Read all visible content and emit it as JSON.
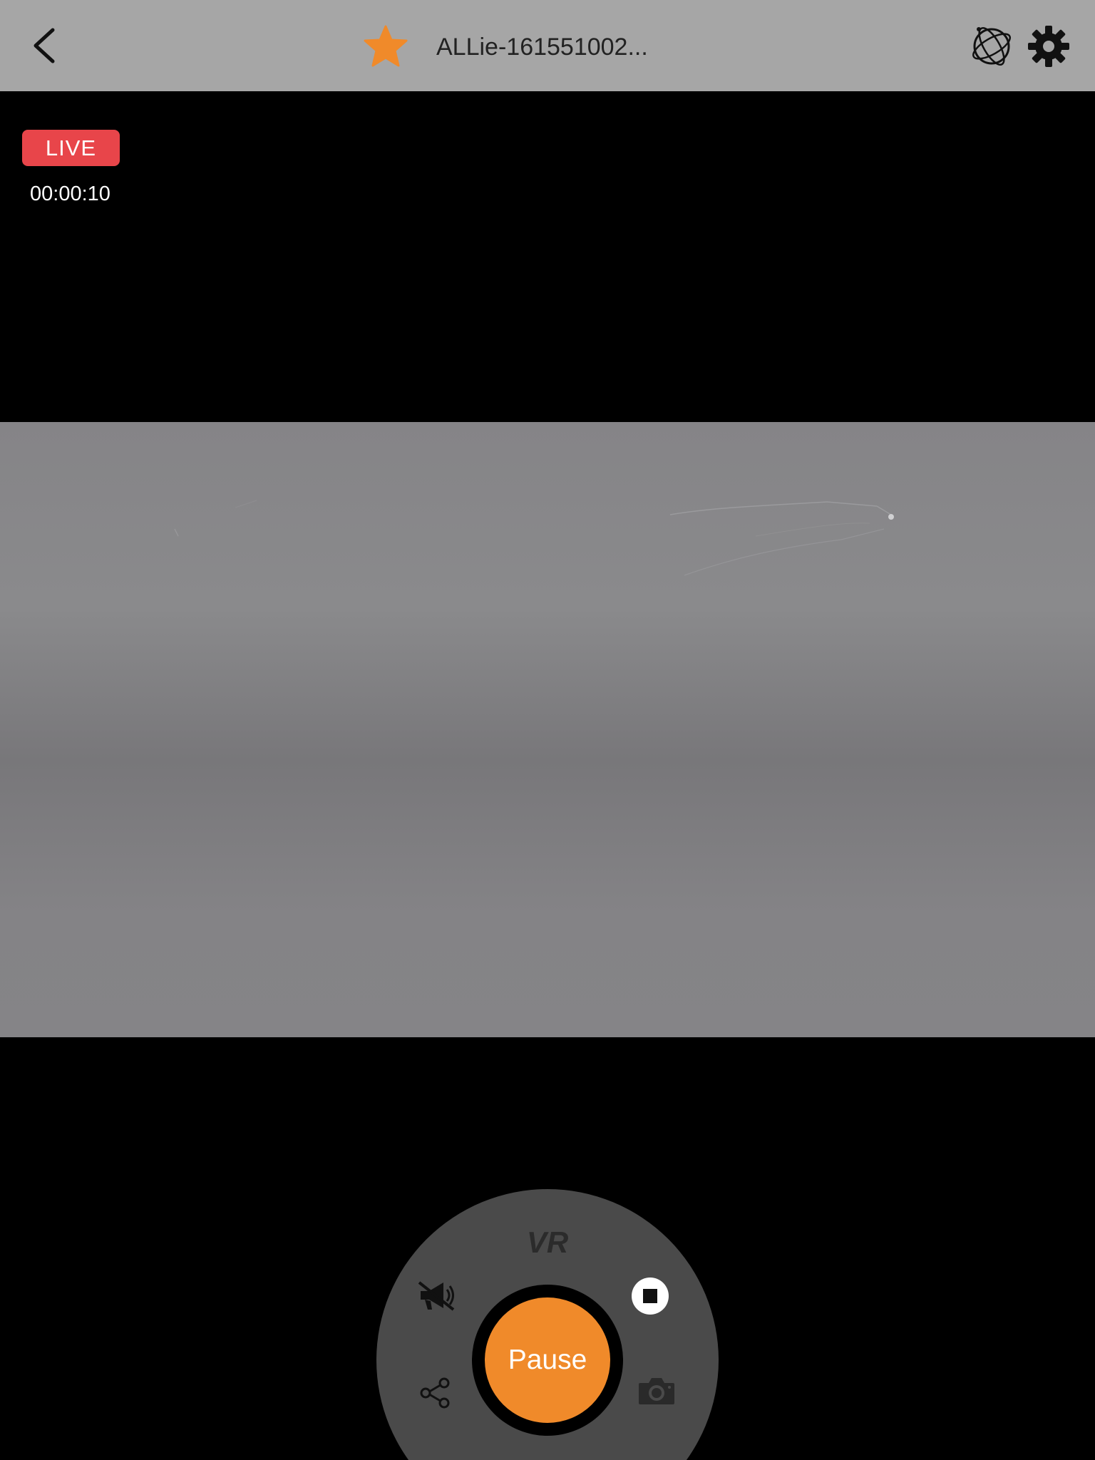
{
  "header": {
    "back_icon": "chevron-left-icon",
    "favorite_icon": "star-icon",
    "title": "ALLie-161551002...",
    "orbit_icon": "orbit-icon",
    "settings_icon": "gear-icon"
  },
  "live": {
    "badge": "LIVE",
    "timer": "00:00:10"
  },
  "controls": {
    "vr_label": "VR",
    "mute_icon": "megaphone-muted-icon",
    "stop_icon": "stop-icon",
    "share_icon": "share-icon",
    "camera_icon": "camera-icon",
    "pause_label": "Pause"
  },
  "colors": {
    "topbar": "#a6a6a6",
    "live_badge": "#e8454a",
    "pause_button": "#f08a2a",
    "star": "#f08a2a",
    "wheel": "#4a4a4a"
  }
}
